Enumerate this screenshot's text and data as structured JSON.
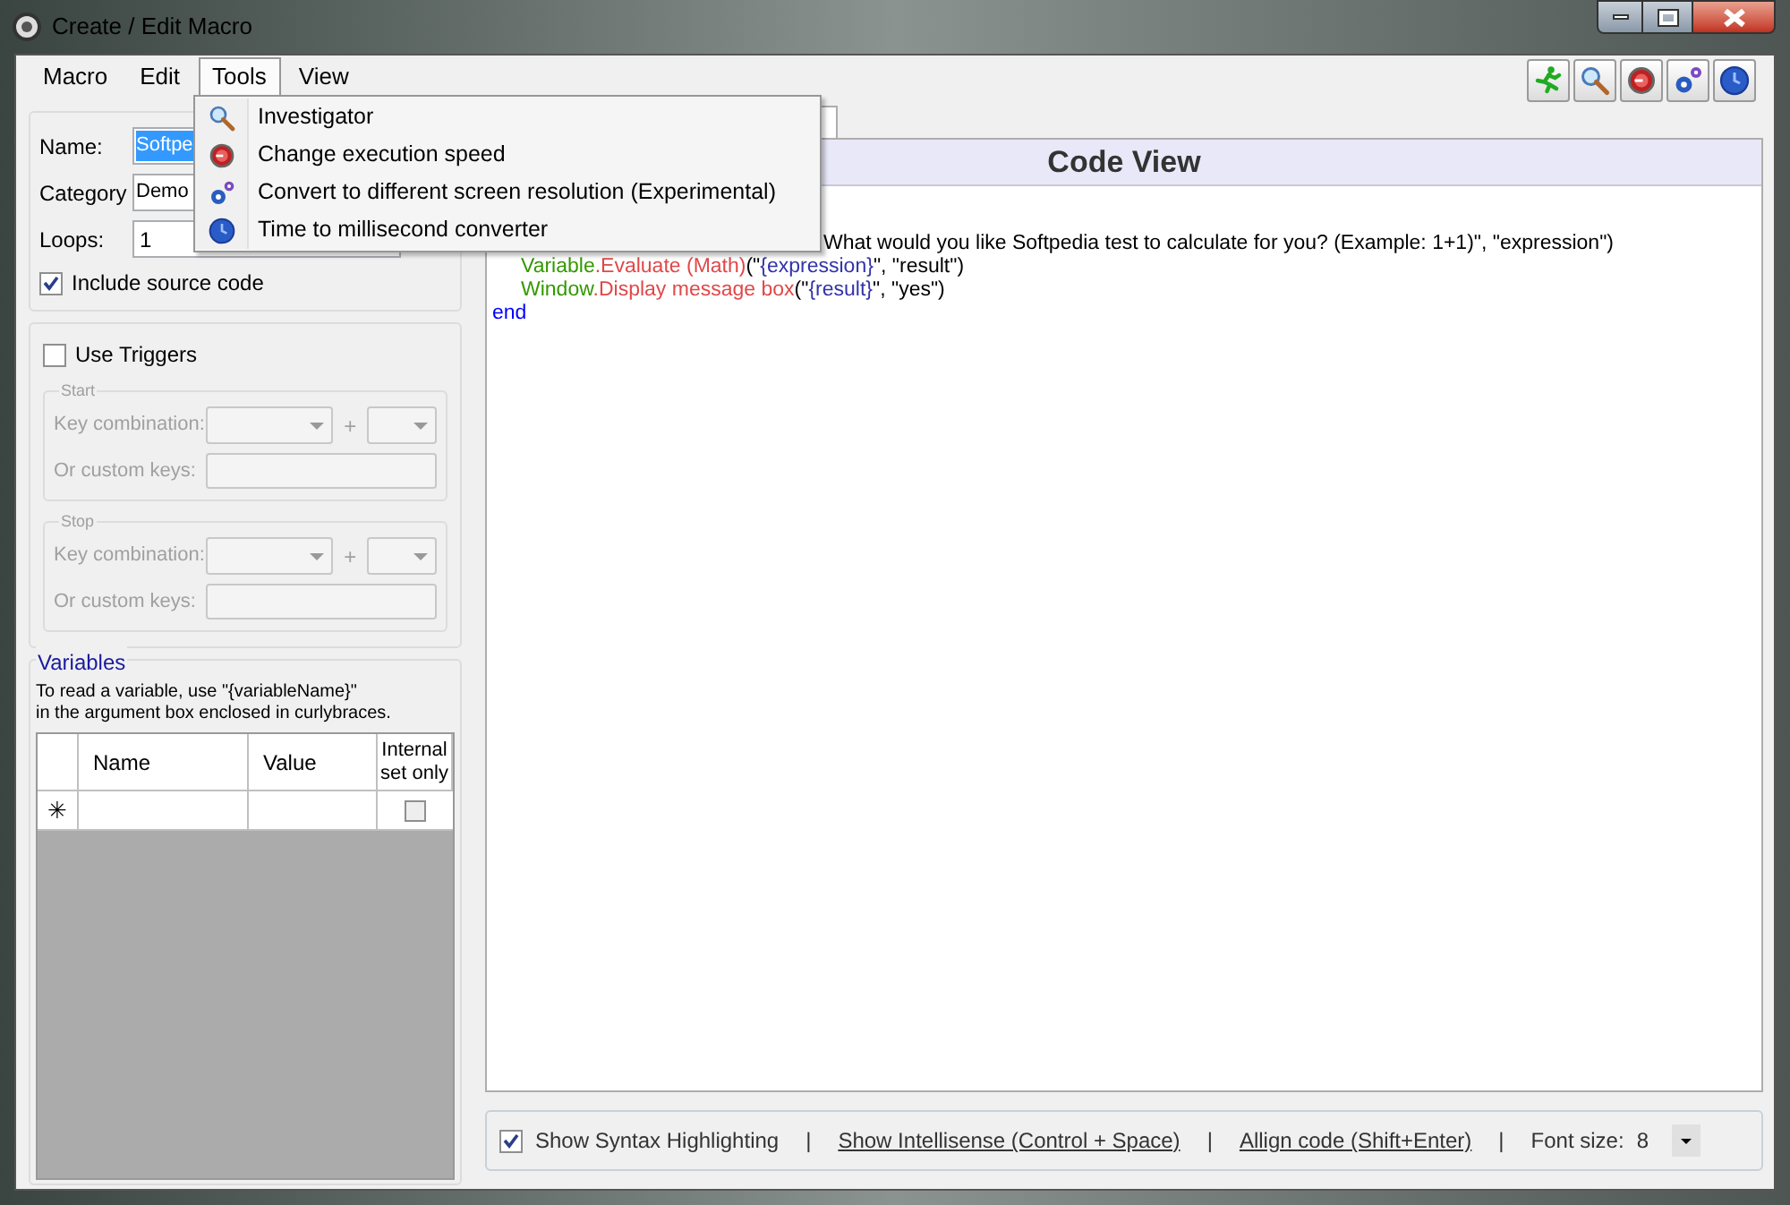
{
  "window": {
    "title": "Create / Edit Macro"
  },
  "menu_bar": [
    {
      "label": "Macro",
      "selected": false
    },
    {
      "label": "Edit",
      "selected": false
    },
    {
      "label": "Tools",
      "selected": true
    },
    {
      "label": "View",
      "selected": false
    }
  ],
  "tools_menu": [
    {
      "label": "Investigator",
      "kind": "magnifier"
    },
    {
      "label": "Change execution speed",
      "kind": "stopwatch"
    },
    {
      "label": "Convert to different screen resolution (Experimental)",
      "kind": "gears"
    },
    {
      "label": "Time to millisecond converter",
      "kind": "clock"
    }
  ],
  "toolbar": [
    {
      "kind": "runner"
    },
    {
      "kind": "magnifier"
    },
    {
      "kind": "stopwatch"
    },
    {
      "kind": "gears"
    },
    {
      "kind": "clock"
    }
  ],
  "macro": {
    "name_label": "Name:",
    "name_value": "Softpe",
    "category_label": "Category",
    "category_value": "Demo",
    "loops_label": "Loops:",
    "loops_value": "1",
    "include_source": {
      "label": "Include source code",
      "checked": true
    }
  },
  "triggers": {
    "label": "Use Triggers",
    "checked": false,
    "groups": [
      {
        "title": "Start",
        "key_label": "Key combination:",
        "plus": "+",
        "custom_label": "Or custom keys:"
      },
      {
        "title": "Stop",
        "key_label": "Key combination:",
        "plus": "+",
        "custom_label": "Or custom keys:"
      }
    ]
  },
  "variables": {
    "title": "Variables",
    "hint": [
      "To read a variable, use \"{variableName}\"",
      "in the argument box enclosed in curlybraces."
    ],
    "columns": [
      "Name",
      "Value",
      "Internal set only"
    ],
    "new_row": {
      "marker": "✳",
      "checked": false
    }
  },
  "code_view": {
    "title": "Code View",
    "lines": [
      {
        "kind": "partial",
        "segments": [
          {
            "text": "What would you like Softpedia test to calculate for you? (Example: 1+1)\", \"expression\")",
            "color": "#000000"
          }
        ]
      },
      {
        "kind": "body",
        "segments": [
          {
            "text": "Variable",
            "color": "#339900"
          },
          {
            "text": ".Evaluate (Math)",
            "color": "#e04848"
          },
          {
            "text": "(\"",
            "color": "#000000"
          },
          {
            "text": "{expression}",
            "color": "#3333aa"
          },
          {
            "text": "\", \"result\")",
            "color": "#000000"
          }
        ]
      },
      {
        "kind": "body",
        "segments": [
          {
            "text": "Window",
            "color": "#339900"
          },
          {
            "text": ".Display message box",
            "color": "#e04848"
          },
          {
            "text": "(\"",
            "color": "#000000"
          },
          {
            "text": "{result}",
            "color": "#3333aa"
          },
          {
            "text": "\", \"yes\")",
            "color": "#000000"
          }
        ]
      },
      {
        "kind": "plain",
        "segments": [
          {
            "text": "end",
            "color": "#0000ff"
          }
        ]
      }
    ]
  },
  "footer": [
    {
      "kind": "checkbox",
      "text": "Show Syntax Highlighting",
      "checked": true
    },
    {
      "kind": "separator",
      "text": "|"
    },
    {
      "kind": "link",
      "text": "Show Intellisense (Control + Space)"
    },
    {
      "kind": "separator",
      "text": "|"
    },
    {
      "kind": "link",
      "text": "Allign code (Shift+Enter)"
    },
    {
      "kind": "separator",
      "text": "|"
    },
    {
      "kind": "dropdown",
      "label": "Font size:",
      "value": "8"
    }
  ]
}
